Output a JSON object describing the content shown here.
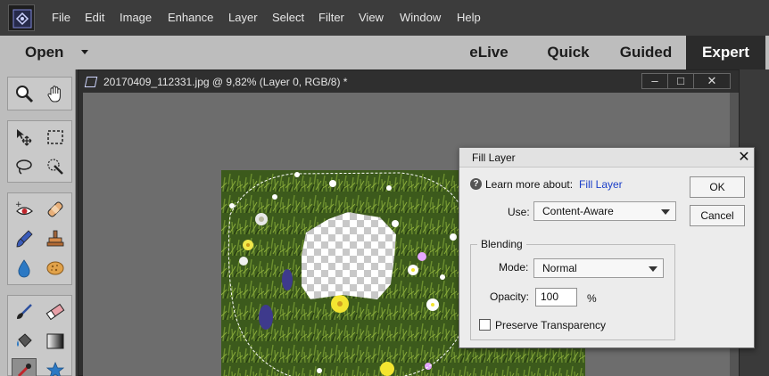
{
  "menubar": {
    "items": [
      "File",
      "Edit",
      "Image",
      "Enhance",
      "Layer",
      "Select",
      "Filter",
      "View",
      "Window",
      "Help"
    ]
  },
  "modebar": {
    "open_label": "Open",
    "tabs": [
      "eLive",
      "Quick",
      "Guided",
      "Expert"
    ],
    "active_tab": "Expert"
  },
  "document": {
    "title": "20170409_112331.jpg @ 9,82% (Layer 0, RGB/8) *",
    "window_buttons": [
      "minimize",
      "maximize",
      "close"
    ]
  },
  "toolbox": {
    "tools": [
      "zoom",
      "hand",
      "move",
      "rectangular-marquee",
      "lasso",
      "quick-selection",
      "red-eye",
      "spot-healing",
      "smart-brush",
      "clone-stamp",
      "blur",
      "sponge",
      "brush",
      "eraser",
      "paint-bucket",
      "gradient",
      "color-picker",
      "custom-shape"
    ],
    "active_tool": "color-picker"
  },
  "dialog": {
    "title": "Fill Layer",
    "learn_prefix": "Learn more about:",
    "learn_link": "Fill Layer",
    "use_label": "Use:",
    "use_value": "Content-Aware",
    "blending_label": "Blending",
    "mode_label": "Mode:",
    "mode_value": "Normal",
    "opacity_label": "Opacity:",
    "opacity_value": "100",
    "opacity_unit": "%",
    "preserve_label": "Preserve Transparency",
    "preserve_checked": false,
    "ok_label": "OK",
    "cancel_label": "Cancel"
  },
  "colors": {
    "menubar_bg": "#3c3c3c",
    "modebar_bg": "#bdbdbd",
    "expert_tab_bg": "#2b2b2b",
    "canvas_bg": "#6d6d6d",
    "dialog_bg": "#ececec",
    "link": "#1a3ec8"
  }
}
